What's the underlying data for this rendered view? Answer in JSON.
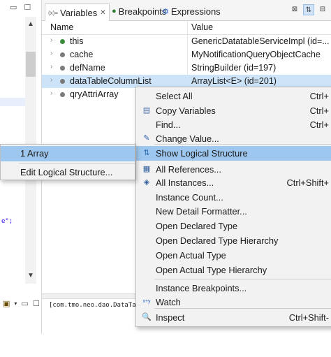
{
  "left_pane": {
    "code_snippet": "e\";"
  },
  "tabs": [
    {
      "icon": "variables-icon",
      "icon_text": "(x)=",
      "label": "Variables",
      "close": "✕"
    },
    {
      "icon": "breakpoints-icon",
      "label": "Breakpoints"
    },
    {
      "icon": "expressions-icon",
      "label": "Expressions"
    }
  ],
  "columns": {
    "name": "Name",
    "value": "Value"
  },
  "variables": [
    {
      "name": "this",
      "value": "GenericDatatableServiceImpl  (id=...",
      "dot_color": "#3c8a3c",
      "selected": false
    },
    {
      "name": "cache",
      "value": "MyNotificationQueryObjectCache",
      "dot_color": "#7a7a7a",
      "selected": false
    },
    {
      "name": "defName",
      "value": "StringBuilder  (id=197)",
      "dot_color": "#7a7a7a",
      "selected": false
    },
    {
      "name": "dataTableColumnList",
      "value": "ArrayList<E>  (id=201)",
      "dot_color": "#7a7a7a",
      "selected": true
    },
    {
      "name": "qryAttriArray",
      "value": "",
      "dot_color": "#7a7a7a",
      "selected": false
    }
  ],
  "detail_text": "[com.tmo.neo.dao.DataTable",
  "context_menu": {
    "items": [
      {
        "label": "Select All",
        "shortcut": "Ctrl+",
        "icon": ""
      },
      {
        "label": "Copy Variables",
        "shortcut": "Ctrl+",
        "icon": "copy-icon"
      },
      {
        "label": "Find...",
        "shortcut": "Ctrl+",
        "icon": ""
      },
      {
        "label": "Change Value...",
        "shortcut": "",
        "icon": "change-value-icon"
      },
      {
        "label": "Show Logical Structure",
        "shortcut": "",
        "icon": "logical-structure-icon",
        "highlighted": true
      },
      {
        "label": "All References...",
        "shortcut": "",
        "icon": "references-icon"
      },
      {
        "label": "All Instances...",
        "shortcut": "Ctrl+Shift+",
        "icon": "instances-icon"
      },
      {
        "label": "Instance Count...",
        "shortcut": "",
        "icon": ""
      },
      {
        "label": "New Detail Formatter...",
        "shortcut": "",
        "icon": ""
      },
      {
        "label": "Open Declared Type",
        "shortcut": "",
        "icon": ""
      },
      {
        "label": "Open Declared Type Hierarchy",
        "shortcut": "",
        "icon": ""
      },
      {
        "label": "Open Actual Type",
        "shortcut": "",
        "icon": ""
      },
      {
        "label": "Open Actual Type Hierarchy",
        "shortcut": "",
        "icon": ""
      },
      {
        "label": "Instance Breakpoints...",
        "shortcut": "",
        "icon": ""
      },
      {
        "label": "Watch",
        "shortcut": "",
        "icon": "watch-icon",
        "icon_text": "x+y"
      },
      {
        "label": "Inspect",
        "shortcut": "Ctrl+Shift-",
        "icon": "inspect-icon"
      }
    ]
  },
  "submenu": {
    "items": [
      {
        "label": "1 Array",
        "highlighted": true
      },
      {
        "label": "Edit Logical Structure..."
      }
    ]
  }
}
